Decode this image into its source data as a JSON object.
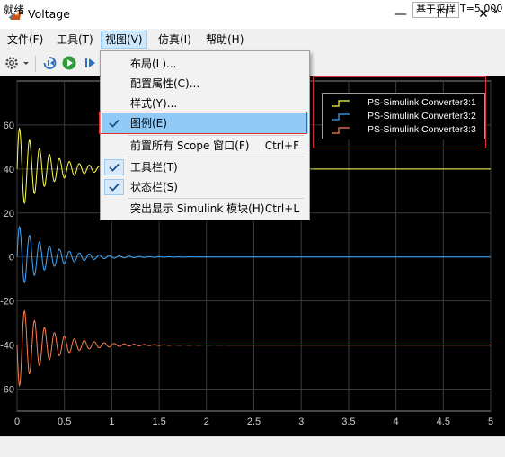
{
  "window": {
    "title": "Voltage",
    "controls": {
      "minimize": "—",
      "maximize": "☐",
      "close": "✕"
    }
  },
  "menubar": {
    "items": [
      "文件(F)",
      "工具(T)",
      "视图(V)",
      "仿真(I)",
      "帮助(H)"
    ],
    "pin": "↘"
  },
  "toolbar": {
    "icons": [
      "gear-icon",
      "dropdown-arrow-icon",
      "step-back-icon",
      "run-icon",
      "step-forward-icon"
    ]
  },
  "view_menu": {
    "items": [
      {
        "label": "布局(L)...",
        "shortcut": "",
        "checked": false
      },
      {
        "label": "配置属性(C)...",
        "shortcut": "",
        "checked": false
      },
      {
        "label": "样式(Y)...",
        "shortcut": "",
        "checked": false
      },
      {
        "label": "图例(E)",
        "shortcut": "",
        "checked": true,
        "highlighted": true
      },
      {
        "label": "前置所有 Scope 窗口(F)",
        "shortcut": "Ctrl+F",
        "checked": false
      },
      {
        "label": "工具栏(T)",
        "shortcut": "",
        "checked": true
      },
      {
        "label": "状态栏(S)",
        "shortcut": "",
        "checked": true
      },
      {
        "label": "突出显示 Simulink 模块(H)",
        "shortcut": "Ctrl+L",
        "checked": false
      }
    ]
  },
  "statusbar": {
    "status": "就绪",
    "trigger": "基于采样",
    "time": "T=5.000"
  },
  "chart_data": {
    "type": "line",
    "xlim": [
      0,
      5
    ],
    "ylim": [
      -70,
      80
    ],
    "xticks": [
      "0",
      "0.5",
      "1",
      "1.5",
      "2",
      "2.5",
      "3",
      "3.5",
      "4",
      "4.5",
      "5"
    ],
    "yticks": [
      "60",
      "40",
      "20",
      "0",
      "-20",
      "-40",
      "-60"
    ],
    "xtick_values": [
      0,
      0.5,
      1,
      1.5,
      2,
      2.5,
      3,
      3.5,
      4,
      4.5,
      5
    ],
    "ytick_values": [
      60,
      40,
      20,
      0,
      -20,
      -40,
      -60
    ],
    "grid": true,
    "legend_position": "top-right",
    "series": [
      {
        "name": "PS-Simulink Converter3:1",
        "color": "#ffff4d",
        "offset": 40,
        "amplitude": 20,
        "decay": 3.2,
        "freq": 9.5
      },
      {
        "name": "PS-Simulink Converter3:2",
        "color": "#3fa9ff",
        "offset": 0,
        "amplitude": 15,
        "decay": 3.2,
        "freq": 9.5
      },
      {
        "name": "PS-Simulink Converter3:3",
        "color": "#ff7f4d",
        "offset": -40,
        "amplitude": 20,
        "decay": 3.2,
        "freq": 9.5
      }
    ]
  }
}
